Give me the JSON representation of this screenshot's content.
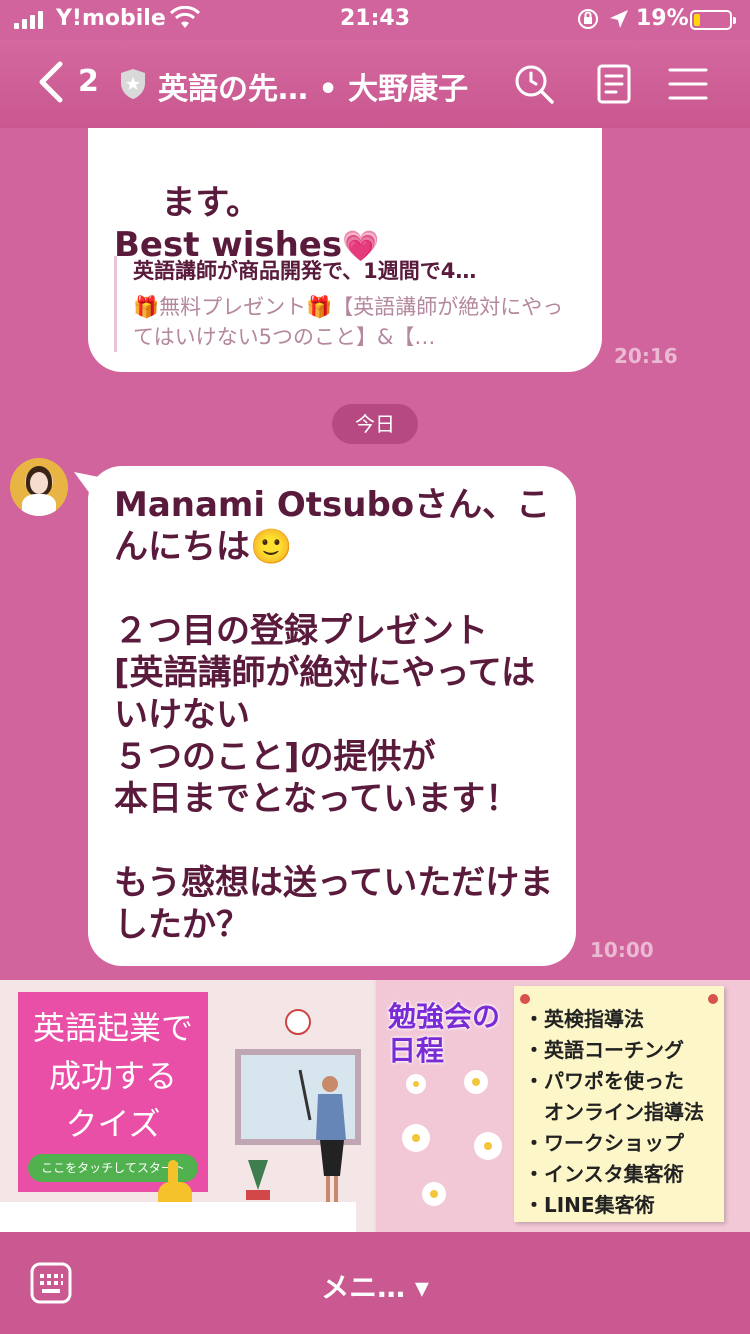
{
  "status_bar": {
    "carrier": "Y!mobile",
    "time": "21:43",
    "battery_percent": "19%"
  },
  "header": {
    "back_count": "2",
    "title": "英語の先… • 大野康子"
  },
  "prev_message": {
    "text": "ます。\nBest wishes",
    "emoji": "💗",
    "link_title": "英語講師が商品開発で、1週間で4…",
    "link_desc": "🎁無料プレゼント🎁【英語講師が絶対にやってはいけない5つのこと】&【…",
    "time": "20:16"
  },
  "date_chip": "今日",
  "message": {
    "text": "Manami Otsuboさん、こんにちは🙂\n\n２つ目の登録プレゼント\n[英語講師が絶対にやってはいけない\n５つのこと]の提供が\n本日までとなっています！\n\nもう感想は送っていただけましたか？",
    "time": "10:00"
  },
  "banner": {
    "quiz_text": "英語起業で\n成功する\nクイズ",
    "quiz_button": "ここをタッチしてスタート",
    "study_title": "勉強会の\n日程",
    "schedule": [
      "・英検指導法",
      "・英語コーチング",
      "・パワポを使った",
      "　オンライン指導法",
      "・ワークショップ",
      "・インスタ集客術",
      "・LINE集客術"
    ]
  },
  "bottom_bar": {
    "menu_label": "メニ… ▾"
  }
}
